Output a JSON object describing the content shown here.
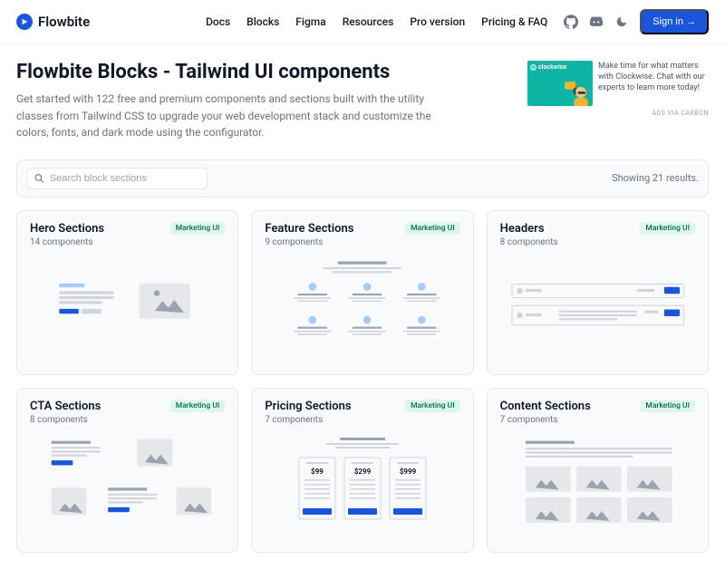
{
  "brand": "Flowbite",
  "nav": {
    "items": [
      "Docs",
      "Blocks",
      "Figma",
      "Resources",
      "Pro version",
      "Pricing & FAQ"
    ],
    "signin": "Sign in →"
  },
  "hero": {
    "title": "Flowbite Blocks - Tailwind UI components",
    "subtitle": "Get started with 122 free and premium components and sections built with the utility classes from Tailwind CSS to upgrade your web development stack and customize the colors, fonts, and dark mode using the configurator."
  },
  "ad": {
    "brand": "clockwise",
    "text": "Make time for what matters with Clockwise. Chat with our experts to learn more today!",
    "via": "ADS VIA CARBON"
  },
  "search": {
    "placeholder": "Search block sections"
  },
  "results": "Showing 21 results.",
  "badge": "Marketing UI",
  "pricing": {
    "p1": "$99",
    "p2": "$299",
    "p3": "$999"
  },
  "cards": [
    {
      "title": "Hero Sections",
      "sub": "14 components"
    },
    {
      "title": "Feature Sections",
      "sub": "9 components"
    },
    {
      "title": "Headers",
      "sub": "8 components"
    },
    {
      "title": "CTA Sections",
      "sub": "8 components"
    },
    {
      "title": "Pricing Sections",
      "sub": "7 components"
    },
    {
      "title": "Content Sections",
      "sub": "7 components"
    }
  ]
}
